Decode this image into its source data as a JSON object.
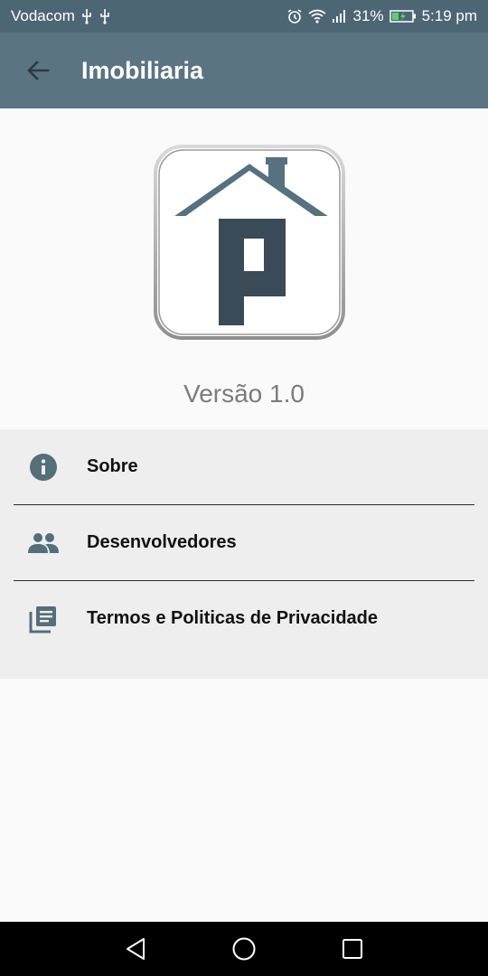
{
  "status_bar": {
    "carrier": "Vodacom",
    "battery_percent": "31%",
    "time": "5:19 pm"
  },
  "app_bar": {
    "title": "Imobiliaria"
  },
  "about": {
    "version": "Versão 1.0"
  },
  "menu": {
    "items": [
      {
        "label": "Sobre",
        "icon": "info-icon"
      },
      {
        "label": "Desenvolvedores",
        "icon": "people-icon"
      },
      {
        "label": "Termos e Politicas de Privacidade",
        "icon": "library-books-icon"
      }
    ]
  },
  "colors": {
    "status_bar": "#4d6674",
    "app_bar": "#5a7482",
    "icon": "#546e7a",
    "logo_dark": "#3a4a57"
  }
}
